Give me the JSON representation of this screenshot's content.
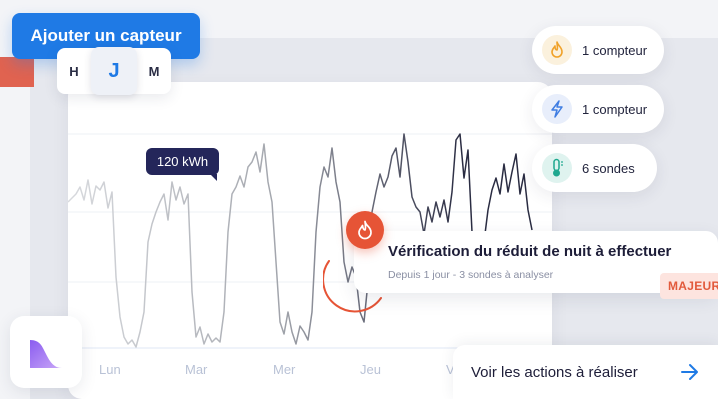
{
  "header": {
    "add_sensor_label": "Ajouter un capteur"
  },
  "period_selector": {
    "options": [
      "H",
      "J",
      "M"
    ],
    "selected": "J"
  },
  "chart": {
    "tooltip": "120 kWh",
    "x_labels": [
      "Lun",
      "Mar",
      "Mer",
      "Jeu",
      "Ve"
    ]
  },
  "meters": [
    {
      "icon": "flame-icon",
      "label": "1 compteur"
    },
    {
      "icon": "lightning-icon",
      "label": "1 compteur"
    },
    {
      "icon": "thermometer-icon",
      "label": "6 sondes"
    }
  ],
  "alert": {
    "title": "Vérification du réduit de nuit à effectuer",
    "subtitle": "Depuis 1 jour - 3 sondes à analyser",
    "severity": "MAJEUR"
  },
  "actions": {
    "label": "Voir les actions à réaliser"
  },
  "colors": {
    "accent": "#1f7ae5",
    "alert": "#e65436",
    "tooltip_bg": "#24265a"
  }
}
